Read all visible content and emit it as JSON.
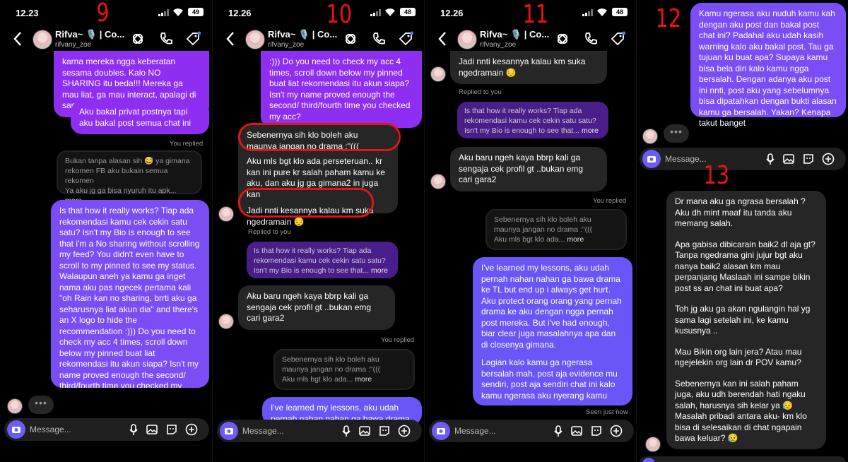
{
  "status_time_a": "12.23",
  "status_time_b": "12.26",
  "battery_a": "49",
  "battery_b": "48",
  "page_numbers": [
    "9",
    "10",
    "11",
    "12",
    "13"
  ],
  "contact": {
    "name": "Rifva~ 🎙️ | Co...",
    "username": "rifvany_zoe"
  },
  "composer_placeholder": "Message...",
  "labels": {
    "you_replied": "You replied",
    "replied_to_you": "Replied to you",
    "seen": "Seen just now",
    "more": "more",
    "typing": "•••"
  },
  "colors": {
    "purple": "#8d2ef0",
    "violet": "#7a4ef4",
    "incoming": "#262626",
    "annotation": "#e01515"
  },
  "p1": {
    "m1": "karna mereka ngga keberatan sesama doubles. Kalo NO SHARING itu beda!!! Mereka ga mau liat, ga mau interact, apalagi di samperin deluan.",
    "m2": "Aku bakal privat postnya tapi aku bakal post semua chat ini",
    "reply": "Bukan tanpa alasan sih 😅 ya gimana rekomen FB aku bukain semua rekomen",
    "reply2": "Ya aku jg ga bisa nyuruh itu apk...",
    "m3": "Is that how it really works? Tiap ada rekomendasi kamu cek cekin satu satu? Isn't my Bio is enough to see that i'm a No sharing without scrolling my feed? You didn't even have to scroll to my pinned to see my status. Walaupun aneh ya kamu ga inget nama aku pas ngecek pertama kali \"oh Rain kan no sharing, brrti aku ga seharusnya liat akun dia\" and there's an X logo to hide the recommendation :))) Do you need to check my acc 4 times, scroll down below my pinned buat liat rekomendasi itu akun siapa? Isn't my name proved enough the second/ third/fourth time you checked my acc?"
  },
  "p2": {
    "m1": ":))) Do you need to check my acc 4 times, scroll down below my pinned buat liat rekomendasi itu akun siapa? Isn't my name proved enough the second/ third/fourth time you checked my acc?",
    "m2a": "Sebenernya sih klo boleh aku maunya jangan no drama :\"(((",
    "m2b": "Aku mls bgt klo ada perseteruan.. kr kan ini pure kr salah paham kamu ke aku, dan aku jg ga gimana2 in juga kan",
    "m2c": "Jadi nnti kesannya kalau km suka ngedramain 😔",
    "reply": "Is that how it really works? Tiap ada rekomendasi kamu cek cekin satu satu? Isn't my Bio is enough to see that...",
    "m3": "Aku baru ngeh kaya bbrp kali ga sengaja cek profil gt ..bukan emg cari gara2",
    "myreply": "Sebenernya sih klo boleh aku maunya jangan no drama :\"(((",
    "myreply2": "Aku mls bgt klo ada...",
    "m4": "I've learned my lessons, aku udah pernah nahan nahan ga bawa drama"
  },
  "p3": {
    "m1": "Jadi nnti kesannya kalau km suka ngedramain 😔",
    "reply": "Is that how it really works? Tiap ada rekomendasi kamu cek cekin satu satu? Isn't my Bio is enough to see that...",
    "m2": "Aku baru ngeh kaya bbrp kali ga sengaja cek profil gt ..bukan emg cari gara2",
    "myreply": "Sebenernya sih klo boleh aku maunya jangan no drama :\"(((",
    "myreply2": "Aku mls bgt klo ada...",
    "m3": "I've learned my lessons, aku udah pernah nahan nahan ga bawa drama ke TL but end up i always get hurt. Aku protect orang orang yang pernah drama ke aku dengan ngga pernah post mereka. But i've had enough, biar clear juga masalahnya apa dan di closenya gimana.",
    "m4": "Lagian kalo kamu ga ngerasa bersalah mah, post aja evidence mu sendiri, post aja sendiri chat ini kalo kamu ngerasa aku nyerang kamu"
  },
  "p4": {
    "m1": "Kamu ngerasa aku nuduh kamu kah dengan aku post dan bakal post chat ini? Padahal aku udah kasih warning kalo aku bakal post. Tau ga tujuan ku buat apa? Supaya kamu bisa bela diri kalo kamu ngga bersalah. Dengan adanya aku post ini nnti, post aku yang sebelumnya bisa dipatahkan dengan bukti alasan kamu ga bersalah. Yakan? Kenapa takut banget",
    "m2": "Dr mana aku ga ngrasa bersalah ? Aku dh mint maaf itu tanda aku memang salah.",
    "m3": "Apa gabisa dibicarain baik2 dl aja gt? Tanpa ngedrama gini jujur bgt aku nanya baik2 alasan km mau perpanjang Maslaah ini sampe bikin post ss an chat ini buat apa?",
    "m4": "Toh jg aku ga akan ngulangin hal yg sama lagi setelah ini, ke kamu kususnya ..",
    "m5": "Mau Bikin org lain jera? Atau mau ngejelekin org lain dr POV kamu?",
    "m6": "Sebenernya kan ini salah paham juga, aku udh berendah hati ngaku salah, harusnya sih kelar ya 😥",
    "m7": "Masalah pribadi antara aku- km klo bisa di selesaikan di chat ngapain bawa keluar? 😥"
  }
}
